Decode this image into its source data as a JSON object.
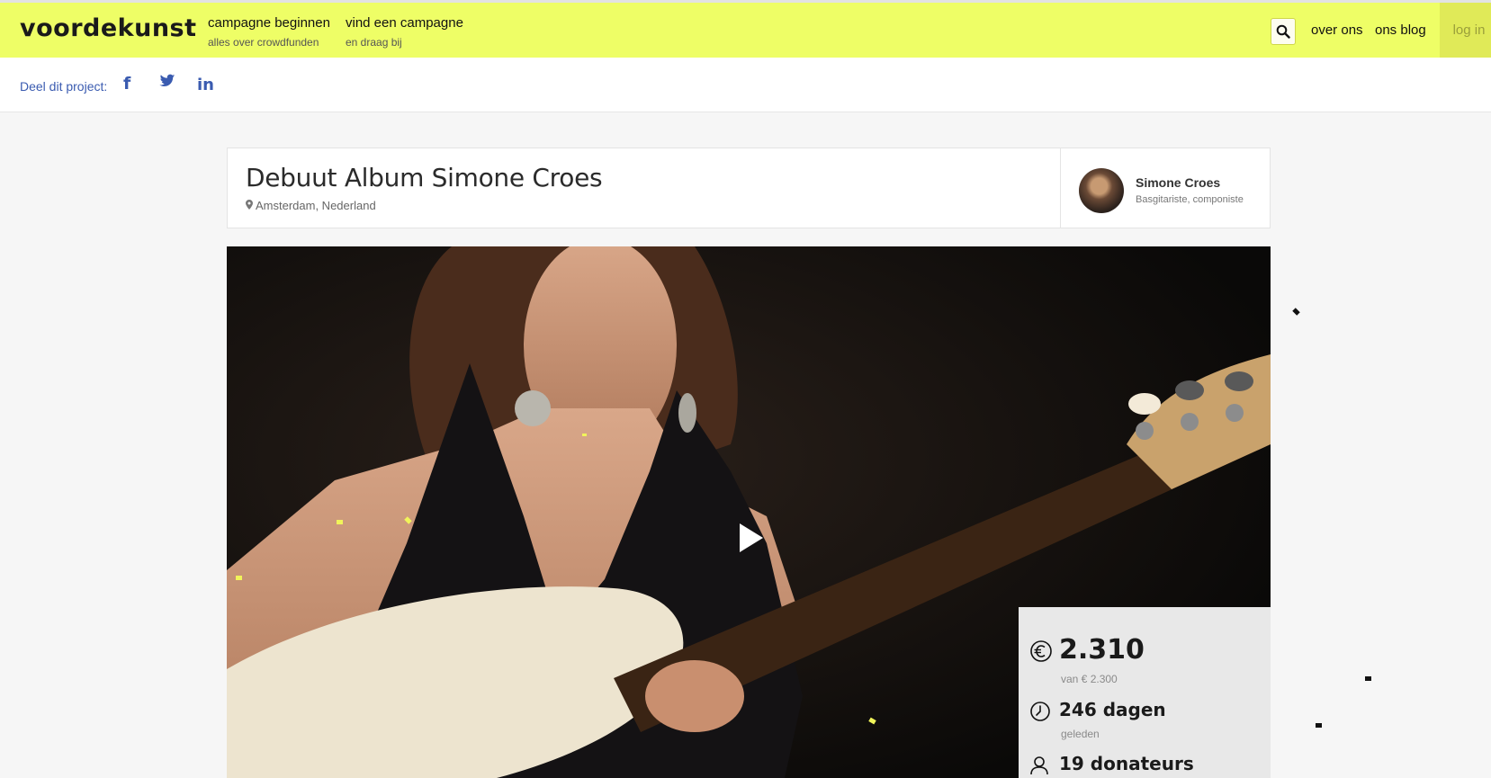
{
  "header": {
    "logo": "voordekunst",
    "nav": [
      {
        "title": "campagne beginnen",
        "subtitle": "alles over crowdfunden"
      },
      {
        "title": "vind een campagne",
        "subtitle": "en draag bij"
      }
    ],
    "search_icon": "search-icon",
    "links": [
      "over ons",
      "ons blog"
    ],
    "login": "log in",
    "colors": {
      "bar": "#eefe66",
      "login_bg": "#e0ea58"
    }
  },
  "share": {
    "label": "Deel dit project:",
    "icons": [
      "facebook-icon",
      "twitter-icon",
      "linkedin-icon"
    ],
    "facebook_glyph": "f",
    "linkedin_glyph": "in",
    "color": "#3a5bb0"
  },
  "project": {
    "title": "Debuut Album Simone Croes",
    "location": "Amsterdam, Nederland"
  },
  "author": {
    "name": "Simone Croes",
    "role": "Basgitariste, componiste"
  },
  "video": {
    "play_icon": "play-icon"
  },
  "stats": {
    "amount": "2.310",
    "amount_sub": "van € 2.300",
    "days": "246 dagen",
    "days_sub": "geleden",
    "donors": "19 donateurs",
    "icons": [
      "euro-icon",
      "clock-icon",
      "person-icon"
    ]
  }
}
